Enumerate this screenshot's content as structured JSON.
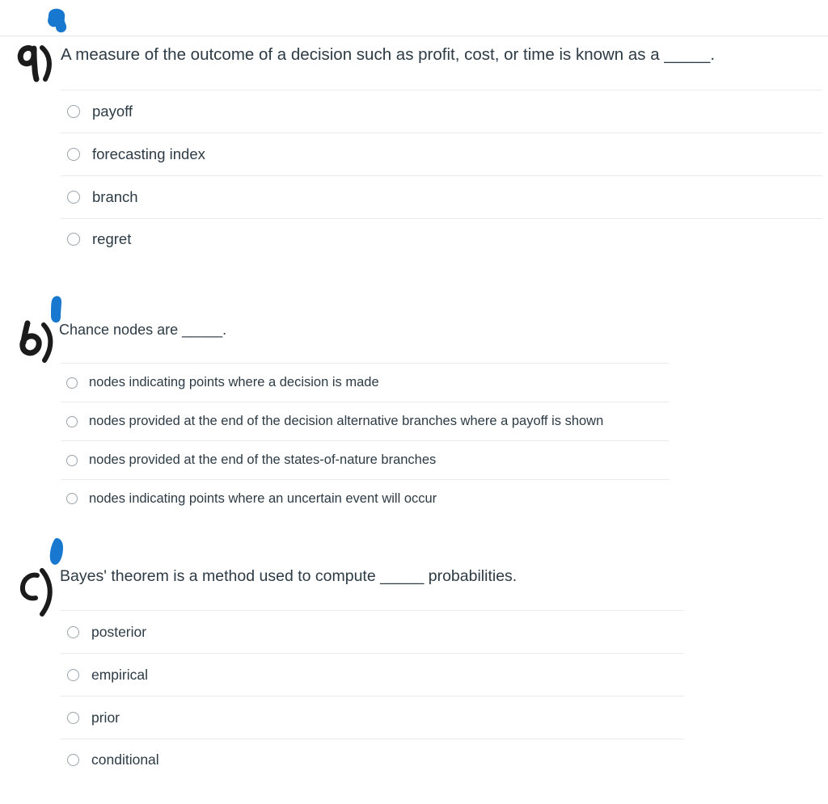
{
  "page": {
    "background_color": "#ffffff",
    "text_color": "#2d3b45",
    "divider_color": "#e8eaec",
    "ink_blue": "#1878d0",
    "ink_black": "#1b1b1b"
  },
  "questions": [
    {
      "annotation_letter": "a)",
      "prompt": "A measure of the outcome of a decision such as profit, cost, or time is known as a _____.",
      "options": [
        "payoff",
        "forecasting index",
        "branch",
        "regret"
      ]
    },
    {
      "annotation_letter": "b)",
      "prompt": "Chance nodes are _____.",
      "options": [
        "nodes indicating points where a decision is made",
        "nodes provided at the end of the decision alternative branches where a payoff is shown",
        "nodes provided at the end of the states-of-nature branches",
        "nodes indicating points where an uncertain event will occur"
      ]
    },
    {
      "annotation_letter": "c)",
      "prompt": "Bayes' theorem is a method used to compute _____ probabilities.",
      "options": [
        "posterior",
        "empirical",
        "prior",
        "conditional"
      ]
    }
  ],
  "annotations": {
    "blue_mark_1": "blue-ink-blob",
    "blue_mark_2": "blue-ink-blob",
    "blue_mark_3": "blue-ink-blob",
    "black_mark_1": "handwritten-letter-a",
    "black_mark_2": "handwritten-letter-b",
    "black_mark_3": "handwritten-letter-c"
  }
}
